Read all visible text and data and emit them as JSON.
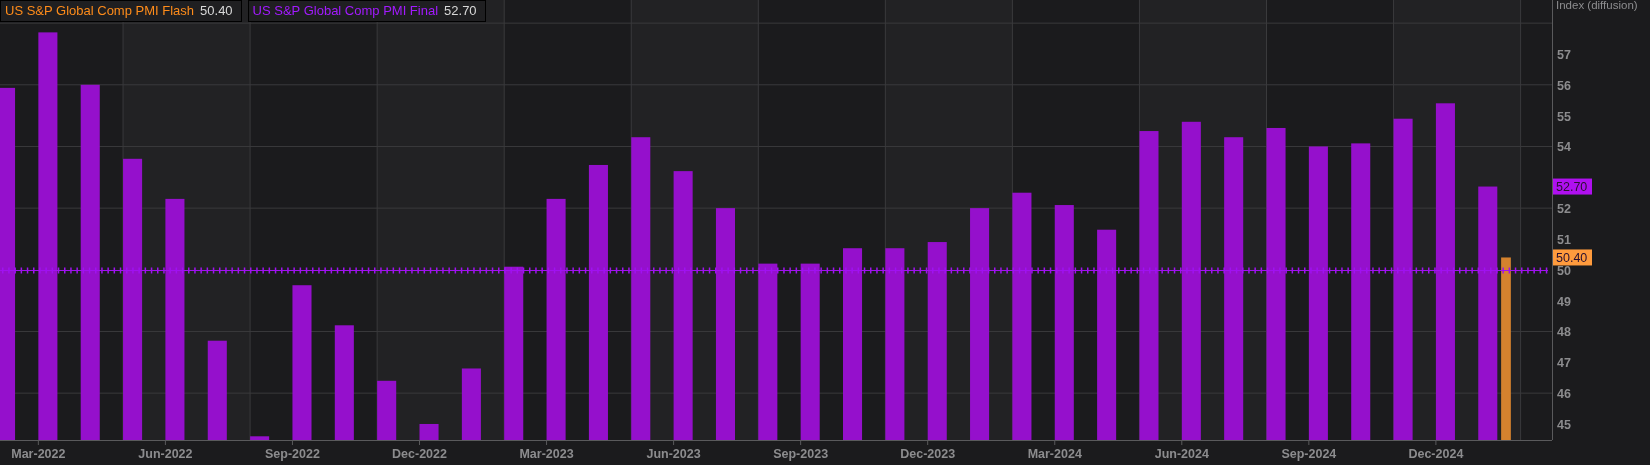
{
  "legend": [
    {
      "value": "50.40",
      "color": "#ff8c1a"
    },
    {
      "value": "52.70",
      "color": "#a31aff"
    }
  ],
  "chart": {
    "chart_data": {
      "type": "bar",
      "ylabel": "Index (diffusion)",
      "categories": [
        null,
        "Mar-2022",
        null,
        null,
        "Jun-2022",
        null,
        null,
        "Sep-2022",
        null,
        null,
        "Dec-2022",
        null,
        null,
        "Mar-2023",
        null,
        null,
        "Jun-2023",
        null,
        null,
        "Sep-2023",
        null,
        null,
        "Dec-2023",
        null,
        null,
        "Mar-2024",
        null,
        null,
        "Jun-2024",
        null,
        null,
        "Sep-2024",
        null,
        null,
        "Dec-2024",
        null,
        null
      ],
      "grid": true,
      "series": [
        {
          "name": "US S&P Global Comp PMI Flash",
          "color": "#d4822e",
          "values": [
            null,
            null,
            null,
            null,
            null,
            null,
            null,
            null,
            null,
            null,
            null,
            null,
            null,
            null,
            null,
            null,
            null,
            null,
            null,
            null,
            null,
            null,
            null,
            null,
            null,
            null,
            null,
            null,
            null,
            null,
            null,
            null,
            null,
            null,
            null,
            null,
            50.4
          ]
        },
        {
          "name": "US S&P Global Comp PMI Final",
          "color": "#9510cc",
          "values": [
            55.9,
            57.7,
            56.0,
            53.6,
            52.3,
            47.7,
            44.6,
            49.5,
            48.2,
            46.4,
            45.0,
            46.8,
            50.1,
            52.3,
            53.4,
            54.3,
            53.2,
            52.0,
            50.2,
            50.2,
            50.7,
            50.7,
            50.9,
            52.0,
            52.5,
            52.1,
            51.3,
            54.5,
            54.8,
            54.3,
            54.6,
            54.0,
            54.1,
            54.9,
            55.4,
            52.7,
            null
          ]
        }
      ],
      "ylim": [
        44.48,
        58.75
      ],
      "yticks": [
        45,
        46,
        47,
        48,
        49,
        50,
        51,
        52,
        54,
        55,
        56,
        57
      ]
    },
    "value_tags": [
      {
        "label": "52.70",
        "color": "#b010f0"
      },
      {
        "label": "50.40",
        "color": "#ff9b3d"
      }
    ]
  }
}
